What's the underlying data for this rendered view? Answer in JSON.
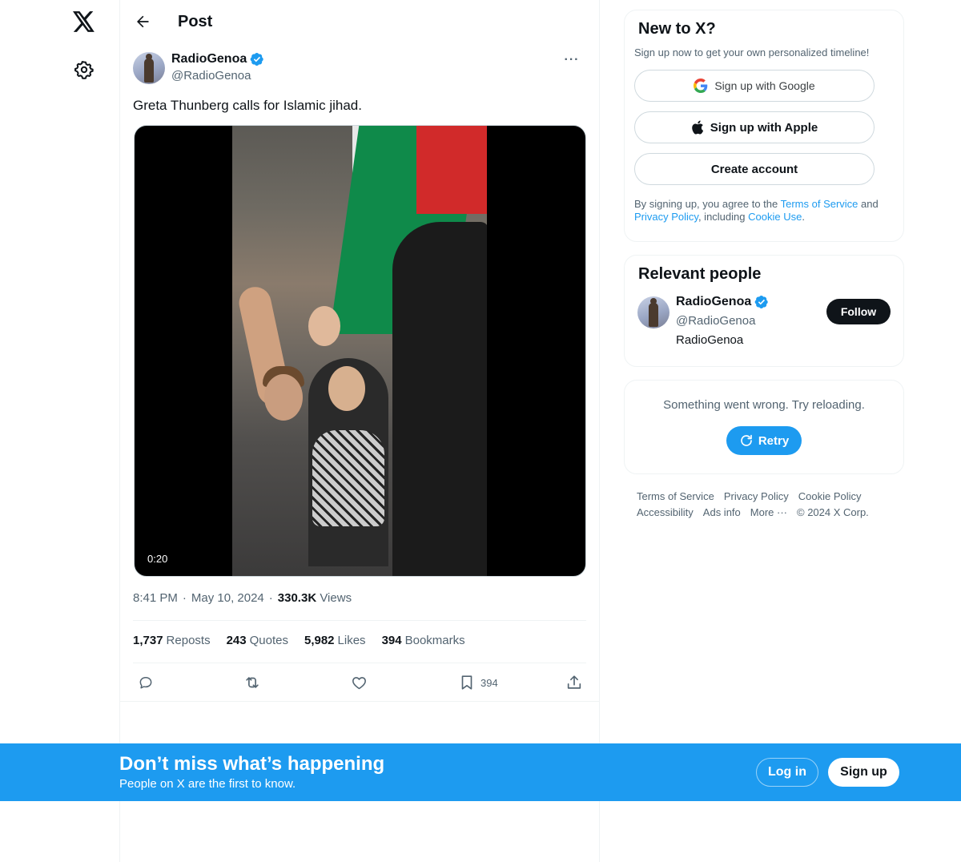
{
  "nav": {
    "logo_icon": "x-logo-icon",
    "settings_icon": "gear-icon"
  },
  "header": {
    "title": "Post",
    "back_icon": "arrow-left-icon"
  },
  "post": {
    "author_name": "RadioGenoa",
    "author_handle": "@RadioGenoa",
    "more_label": "···",
    "text": "Greta Thunberg calls for Islamic jihad.",
    "video_duration": "0:20",
    "time": "8:41 PM",
    "date": "May 10, 2024",
    "views_count": "330.3K",
    "views_label": "Views",
    "sep": "·",
    "stats": {
      "reposts_count": "1,737",
      "reposts_label": "Reposts",
      "quotes_count": "243",
      "quotes_label": "Quotes",
      "likes_count": "5,982",
      "likes_label": "Likes",
      "bookmarks_count": "394",
      "bookmarks_label": "Bookmarks"
    },
    "actions": {
      "bookmark_count": "394"
    }
  },
  "sidebar": {
    "new_to_x": {
      "title": "New to X?",
      "subtitle": "Sign up now to get your own personalized timeline!",
      "google_label": "Sign up with Google",
      "apple_label": "Sign up with Apple",
      "create_label": "Create account",
      "terms_pre": "By signing up, you agree to the ",
      "terms_link": "Terms of Service",
      "terms_and": " and ",
      "privacy_link": "Privacy Policy",
      "terms_mid": ", including ",
      "cookie_link": "Cookie Use",
      "terms_end": "."
    },
    "relevant": {
      "title": "Relevant people",
      "name": "RadioGenoa",
      "handle": "@RadioGenoa",
      "bio": "RadioGenoa",
      "follow_label": "Follow"
    },
    "error": {
      "text": "Something went wrong. Try reloading.",
      "retry_label": "Retry"
    },
    "footer": {
      "terms": "Terms of Service",
      "privacy": "Privacy Policy",
      "cookie": "Cookie Policy",
      "accessibility": "Accessibility",
      "ads": "Ads info",
      "more": "More ···",
      "copyright": "© 2024 X Corp."
    }
  },
  "banner": {
    "title": "Don’t miss what’s happening",
    "subtitle": "People on X are the first to know.",
    "login_label": "Log in",
    "signup_label": "Sign up"
  },
  "colors": {
    "accent": "#1d9bf0",
    "text": "#0f1419",
    "secondary": "#536471",
    "border": "#eff3f4"
  }
}
